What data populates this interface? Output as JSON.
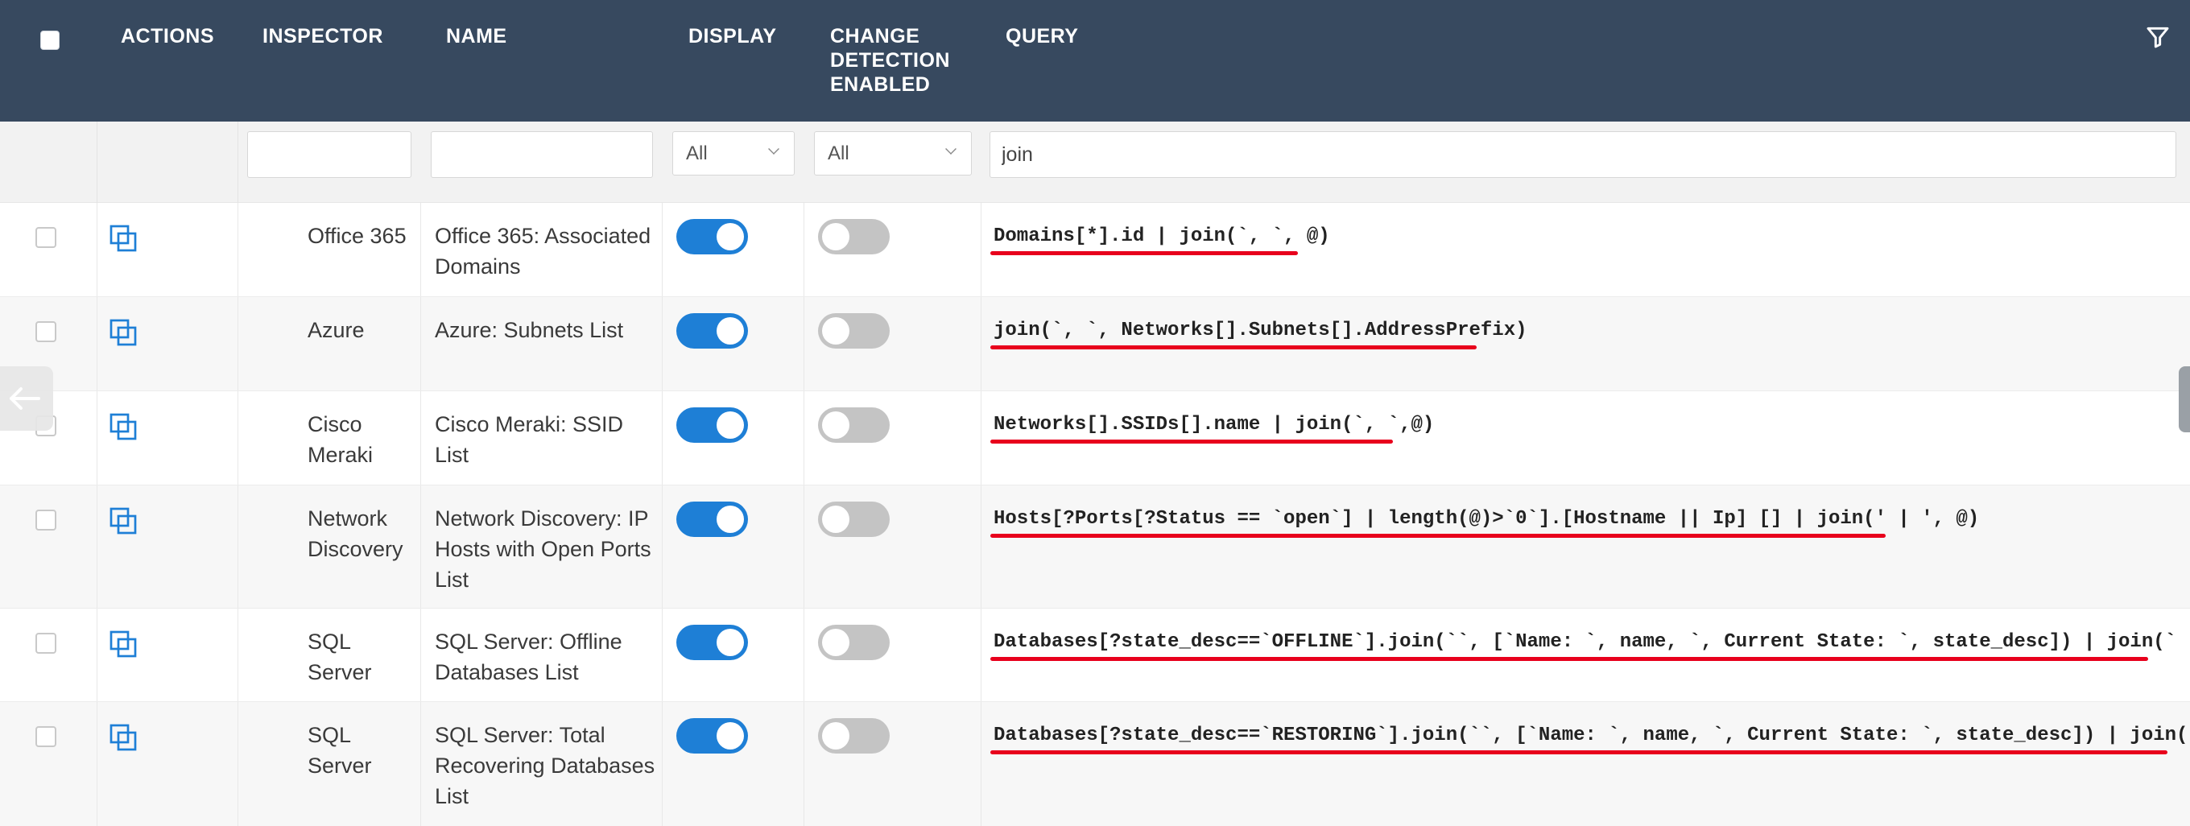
{
  "header": {
    "columns": {
      "actions": "ACTIONS",
      "inspector": "INSPECTOR",
      "name": "NAME",
      "display": "DISPLAY",
      "change_detection": [
        "CHANGE",
        "DETECTION",
        "ENABLED"
      ],
      "query": "QUERY"
    },
    "select_all_checked": false,
    "filter_icon": "funnel-filter-icon",
    "background_color": "#37495f"
  },
  "filters": {
    "inspector_value": "",
    "name_value": "",
    "display_selected": "All",
    "change_detection_selected": "All",
    "query_value": "join"
  },
  "colors": {
    "toggle_on": "#1e7fd6",
    "toggle_off": "#c4c4c4",
    "underline": "#e8001c",
    "action_icon": "#1e7fd6"
  },
  "rows": [
    {
      "inspector": [
        "Office 365"
      ],
      "name": [
        "Office 365: Associated",
        "Domains"
      ],
      "display": true,
      "change_detection": false,
      "query": "Domains[*].id | join(`, `, @)"
    },
    {
      "inspector": [
        "Azure"
      ],
      "name": [
        "Azure: Subnets List"
      ],
      "display": true,
      "change_detection": false,
      "query": "join(`, `, Networks[].Subnets[].AddressPrefix)"
    },
    {
      "inspector": [
        "Cisco",
        "Meraki"
      ],
      "name": [
        "Cisco Meraki: SSID List"
      ],
      "display": true,
      "change_detection": false,
      "query": "Networks[].SSIDs[].name | join(`, `,@)"
    },
    {
      "inspector": [
        "Network",
        "Discovery"
      ],
      "name": [
        "Network Discovery: IP",
        "Hosts with Open Ports",
        "List"
      ],
      "display": true,
      "change_detection": false,
      "query": "Hosts[?Ports[?Status == `open`] | length(@)>`0`].[Hostname || Ip] [] | join(' | ', @)"
    },
    {
      "inspector": [
        "SQL",
        "Server"
      ],
      "name": [
        "SQL Server: Offline",
        "Databases List"
      ],
      "display": true,
      "change_detection": false,
      "query": "Databases[?state_desc==`OFFLINE`].join(``, [`Name: `, name, `, Current State: `, state_desc]) | join(` | `, @)"
    },
    {
      "inspector": [
        "SQL",
        "Server"
      ],
      "name": [
        "SQL Server: Total",
        "Recovering Databases",
        "List"
      ],
      "display": true,
      "change_detection": false,
      "query": "Databases[?state_desc==`RESTORING`].join(``, [`Name: `, name, `, Current State: `, state_desc]) | join(` | `, @)"
    }
  ],
  "side": {
    "back_icon": "arrow-left-icon"
  }
}
